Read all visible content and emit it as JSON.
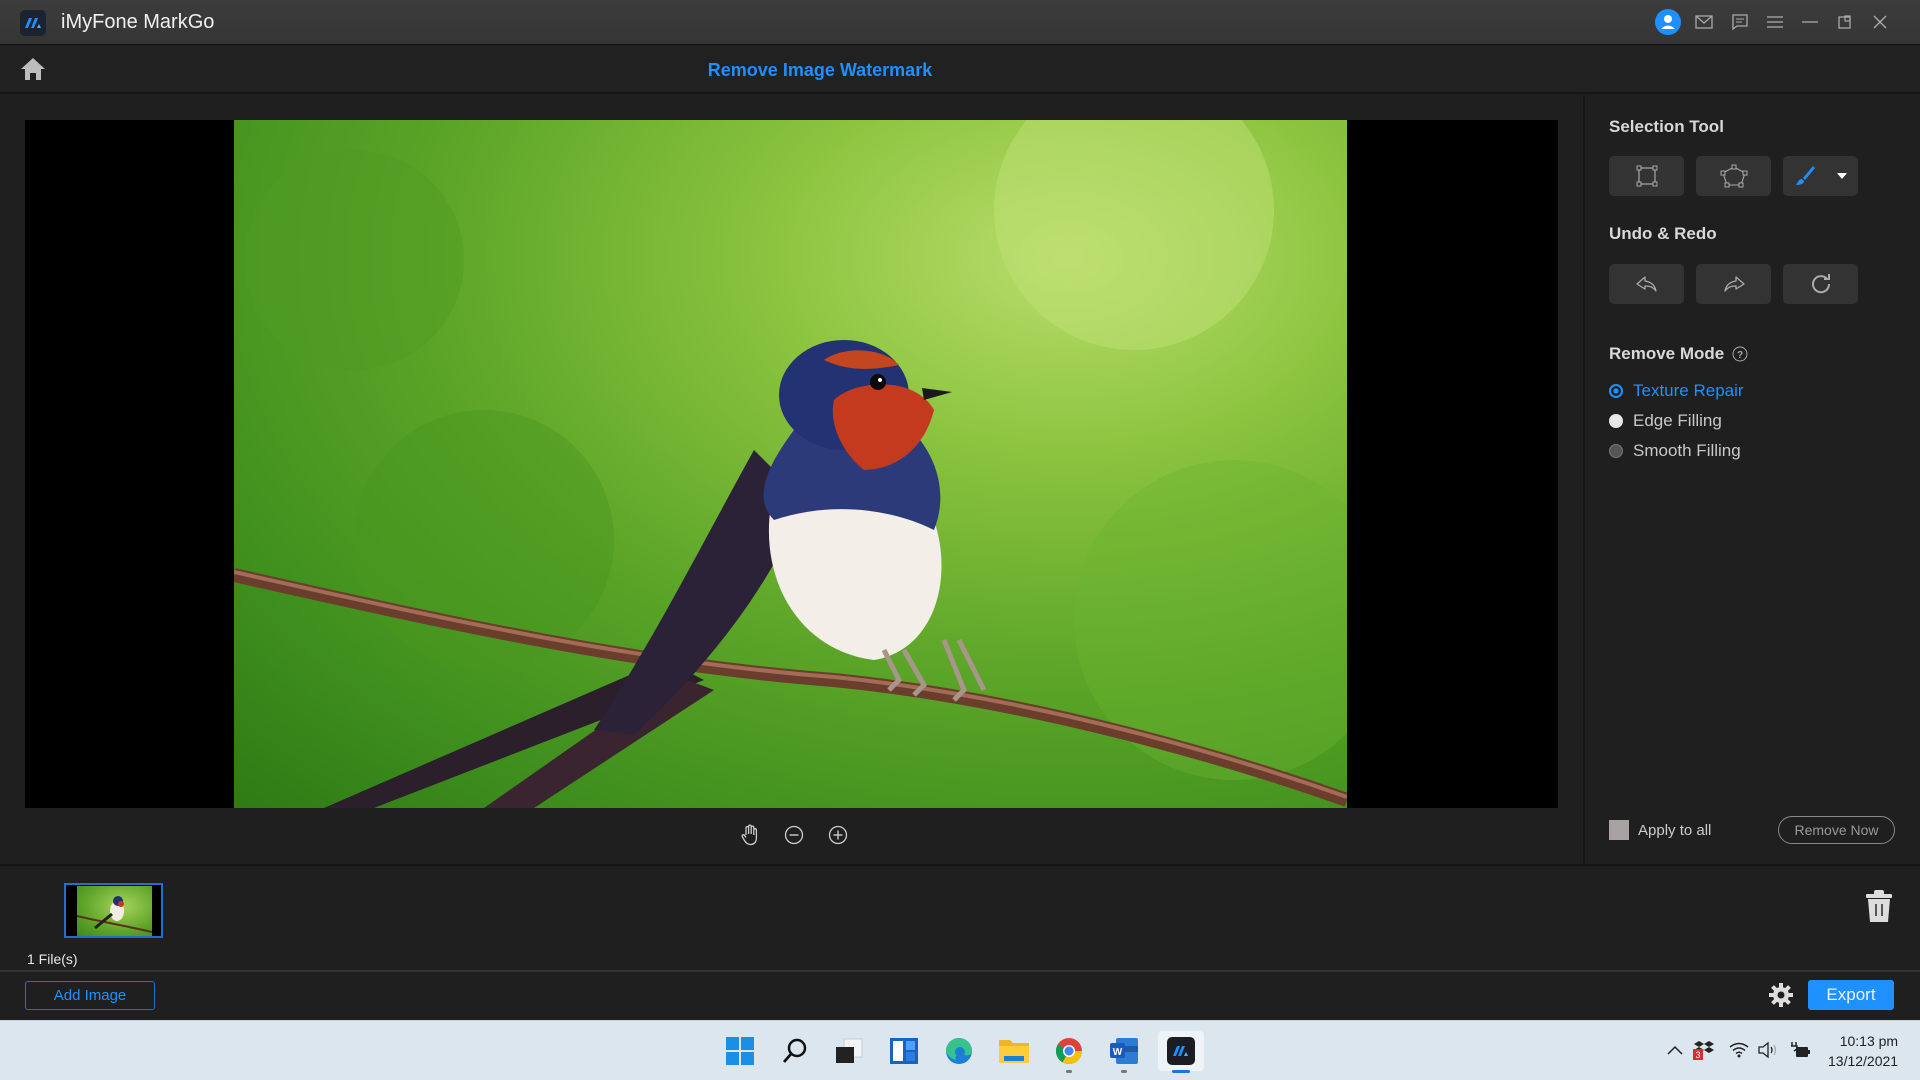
{
  "app": {
    "title": "iMyFone MarkGo",
    "window_controls": [
      "account-icon",
      "mail-icon",
      "feedback-icon",
      "menu-icon",
      "minimize-icon",
      "restore-icon",
      "close-icon"
    ]
  },
  "header": {
    "page_title": "Remove Image Watermark",
    "home_icon": "home-icon"
  },
  "canvas": {
    "image_description": "Barn swallow perched on a rusty wire against a green bokeh background",
    "zoom_controls": [
      "hand-icon",
      "zoom-out-icon",
      "zoom-in-icon"
    ]
  },
  "right_panel": {
    "selection_tool": {
      "title": "Selection Tool",
      "tools": [
        {
          "name": "rectangle-select",
          "icon": "rectangle-select-icon"
        },
        {
          "name": "polygon-select",
          "icon": "polygon-select-icon"
        },
        {
          "name": "brush-select",
          "icon": "brush-icon",
          "selected": true,
          "has_dropdown": true
        }
      ]
    },
    "undo_redo": {
      "title": "Undo & Redo",
      "buttons": [
        {
          "name": "undo",
          "icon": "undo-icon"
        },
        {
          "name": "redo",
          "icon": "redo-icon"
        },
        {
          "name": "reset",
          "icon": "reset-icon"
        }
      ]
    },
    "remove_mode": {
      "title": "Remove Mode",
      "help_icon": "help-icon",
      "options": [
        {
          "label": "Texture Repair",
          "selected": true
        },
        {
          "label": "Edge Filling",
          "selected": false
        },
        {
          "label": "Smooth Filling",
          "selected": false
        }
      ]
    },
    "apply_to_all_label": "Apply to all",
    "apply_to_all_checked": false,
    "remove_now_label": "Remove Now"
  },
  "file_strip": {
    "file_count": "1 File(s)",
    "add_image_label": "Add Image",
    "export_label": "Export"
  },
  "colors": {
    "accent": "#1e90ff",
    "background": "#1f1f1f",
    "titlebar": "#3a3a3a"
  },
  "taskbar": {
    "apps": [
      "start",
      "search",
      "task-view",
      "widgets",
      "edge",
      "file-explorer",
      "chrome",
      "word",
      "markgo"
    ],
    "clock_time": "10:13 pm",
    "clock_date": "13/12/2021",
    "tray_badge": "3"
  }
}
